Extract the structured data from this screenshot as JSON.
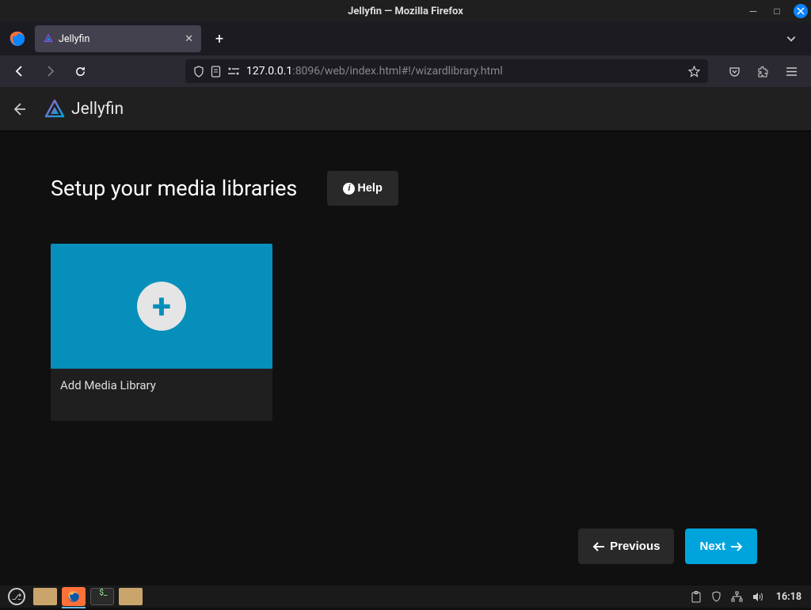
{
  "window": {
    "title": "Jellyfin — Mozilla Firefox"
  },
  "tab": {
    "label": "Jellyfin"
  },
  "url": {
    "host": "127.0.0.1",
    "rest": ":8096/web/index.html#!/wizardlibrary.html"
  },
  "app": {
    "brand": "Jellyfin"
  },
  "page": {
    "heading": "Setup your media libraries",
    "help_label": "Help",
    "card_label": "Add Media Library",
    "prev_label": "Previous",
    "next_label": "Next"
  },
  "taskbar": {
    "clock": "16:18"
  }
}
